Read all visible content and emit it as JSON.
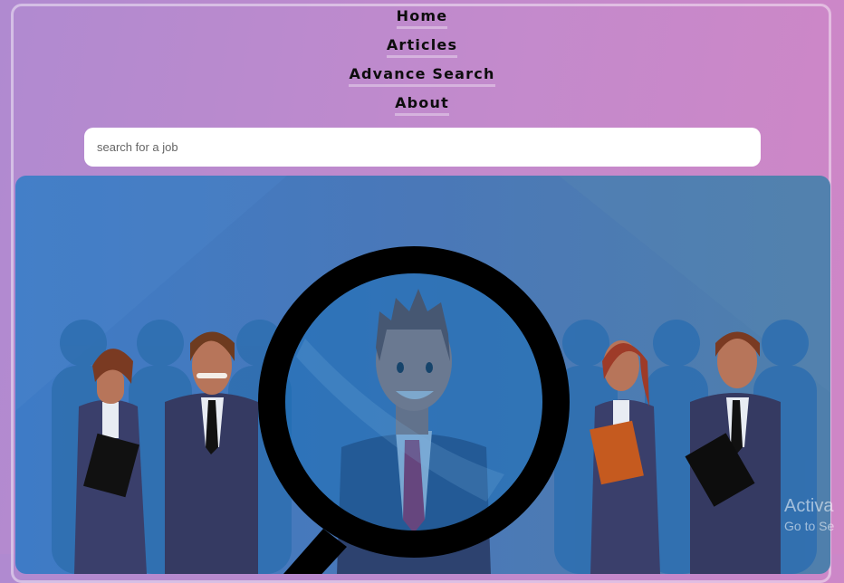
{
  "nav": {
    "items": [
      {
        "label": "Home"
      },
      {
        "label": "Articles"
      },
      {
        "label": "Advance Search"
      },
      {
        "label": "About"
      }
    ]
  },
  "search": {
    "placeholder": "search for a job",
    "value": ""
  },
  "colors": {
    "background": "#c38acc",
    "hero": "#4a78b8",
    "nav_text": "#0d0d0d"
  },
  "watermark": {
    "line1": "Activa",
    "line2": "Go to Se"
  }
}
